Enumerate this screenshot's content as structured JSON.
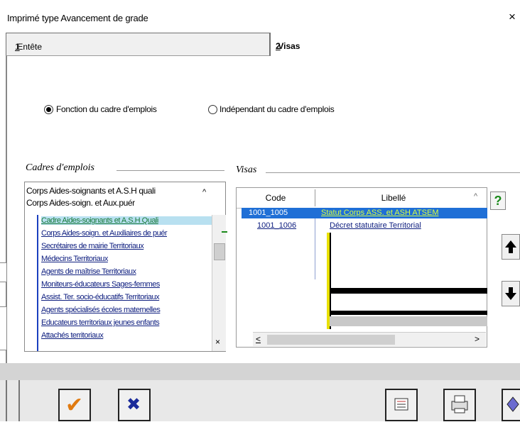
{
  "window": {
    "title": "Imprimé type Avancement de grade",
    "close_glyph": "×"
  },
  "tabs": [
    {
      "num": "1",
      "label": ".Entête"
    },
    {
      "num": "2",
      "label": ".Visas"
    }
  ],
  "radio_group": {
    "options": [
      {
        "label": "Fonction du cadre d'emplois",
        "selected": true
      },
      {
        "label": "Indépendant du cadre d'emplois",
        "selected": false
      }
    ]
  },
  "cadres": {
    "title": "Cadres d'emplois",
    "items": [
      "Corps Aides-soignants et A.S.H quali",
      "Corps Aides-soign. et Aux.puér"
    ],
    "sub_items": [
      "Cadre Aides-soignants et A.S.H Quali",
      "Corps Aides-soign. et Auxiliaires de puér",
      "Secrétaires de mairie Territoriaux",
      "Médecins Territoriaux",
      "Agents de maîtrise Territoriaux",
      "Moniteurs-éducateurs Sages-femmes",
      "Assist. Ter. socio-éducatifs Territoriaux",
      "Agents spécialisés écoles maternelles",
      "Educateurs territoriaux jeunes enfants",
      "Attachés territoriaux"
    ],
    "scroll_up": "^",
    "scroll_x": "×"
  },
  "visas": {
    "title": "Visas",
    "columns": [
      "Code",
      "Libellé"
    ],
    "rows": [
      {
        "code": "1001_1005",
        "libelle": "Statut Corps ASS. et ASH ATSEM"
      },
      {
        "code": "1001_1006",
        "libelle": "Décret statutaire Territorial"
      }
    ],
    "help_glyph": "?",
    "scroll_left": "<",
    "scroll_right": ">",
    "sort_glyph": "^"
  },
  "footer": {
    "ok_glyph": "✔",
    "cancel_glyph": "✖"
  },
  "colors": {
    "ok": "#e07a10",
    "cancel": "#1a2a9a",
    "selection": "#1f6fd6",
    "help": "#1a8a1a"
  }
}
